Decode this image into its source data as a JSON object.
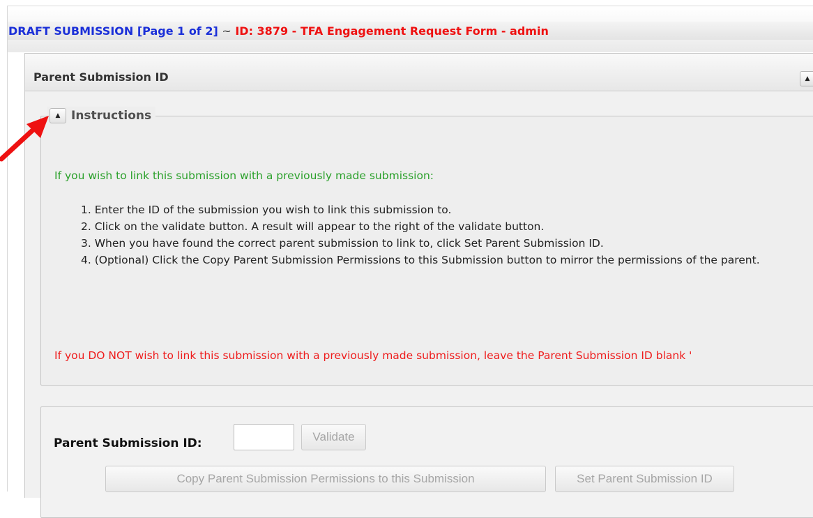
{
  "window": {
    "title_draft": "DRAFT SUBMISSION [Page 1 of 2]",
    "title_separator": "~",
    "title_id": "ID: 3879 - TFA Engagement Request Form - admin"
  },
  "panel": {
    "title": "Parent Submission ID",
    "collapse_icon": "triangle-up-icon"
  },
  "instructions": {
    "legend": "Instructions",
    "legend_icon": "triangle-up-icon",
    "intro": "If you wish to link this submission with a previously made submission:",
    "steps": [
      "1. Enter the ID of the submission you wish to link this submission to.",
      "2. Click on the validate button. A result will appear to the right of the validate button.",
      "3. When you have found the correct parent submission to link to, click Set Parent Submission ID.",
      "4. (Optional) Click the Copy Parent Submission Permissions to this Submission button to mirror the permissions of the parent."
    ],
    "warning": "If you DO NOT wish to link this submission with a previously made submission, leave the Parent Submission ID blank '"
  },
  "form": {
    "parent_id_label": "Parent Submission ID:",
    "parent_id_value": "",
    "validate_label": "Validate",
    "copy_permissions_label": "Copy Parent Submission Permissions to this Submission",
    "set_parent_label": "Set Parent Submission ID"
  },
  "colors": {
    "title_blue": "#1a2fd8",
    "title_red": "#ee1111",
    "intro_green": "#2aa02a",
    "warning_red": "#ee1c1c",
    "annotation_arrow": "#ee1111"
  }
}
